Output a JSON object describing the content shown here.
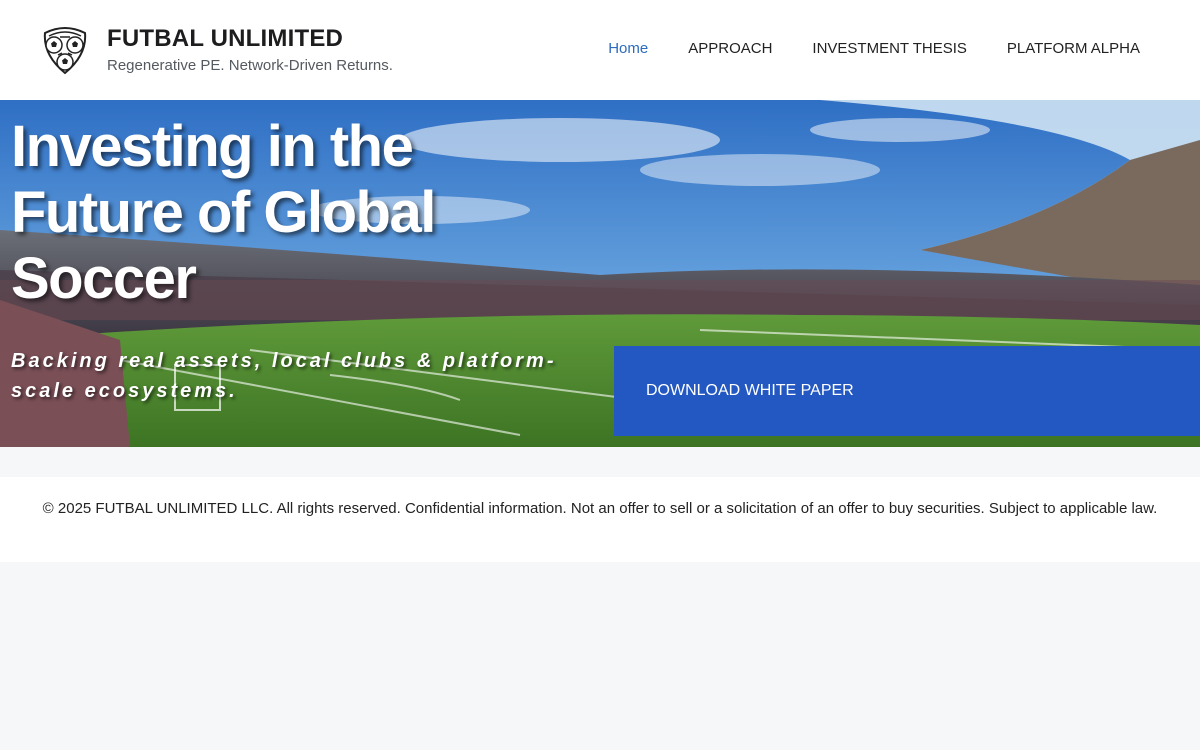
{
  "header": {
    "brand_title": "FUTBAL UNLIMITED",
    "brand_tagline": "Regenerative PE. Network-Driven Returns.",
    "logo_icon": "soccer-ball-shield-icon",
    "nav": [
      {
        "label": "Home",
        "active": true
      },
      {
        "label": "APPROACH",
        "active": false
      },
      {
        "label": "INVESTMENT THESIS",
        "active": false
      },
      {
        "label": "PLATFORM ALPHA",
        "active": false
      }
    ]
  },
  "hero": {
    "title": "Investing in the Future of Global Soccer",
    "subtitle": "Backing real assets, local clubs & platform-scale ecosystems.",
    "cta_label": "DOWNLOAD WHITE PAPER",
    "background_image": "stadium-photo"
  },
  "footer": {
    "legal": "© 2025 FUTBAL UNLIMITED LLC. All rights reserved. Confidential information. Not an offer to sell or a solicitation of an offer to buy securities. Subject to applicable law."
  },
  "colors": {
    "accent": "#2358c2",
    "nav_active": "#2e6bbd",
    "page_bg": "#f6f7f9"
  }
}
